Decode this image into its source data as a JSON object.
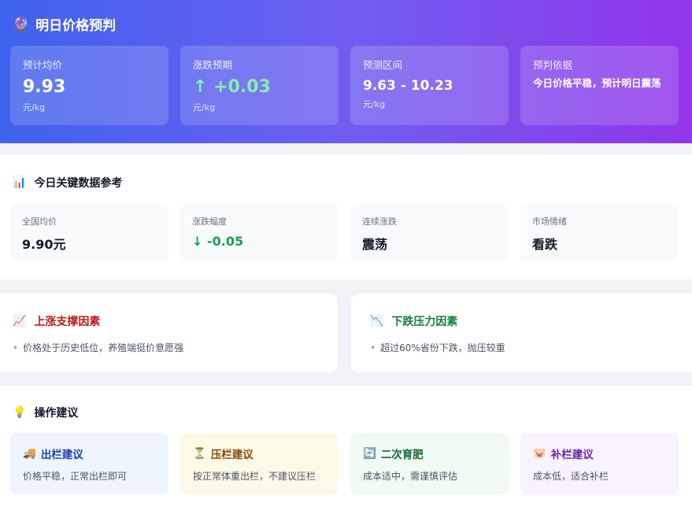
{
  "forecast": {
    "icon": "crystal-ball-person-icon",
    "title": "明日价格预判",
    "cards": {
      "avg": {
        "label": "预计均价",
        "value": "9.93",
        "unit": "元/kg"
      },
      "change": {
        "label": "涨跌预期",
        "value": "↑ +0.03",
        "unit": "元/kg"
      },
      "range": {
        "label": "预测区间",
        "value": "9.63 - 10.23",
        "unit": "元/kg"
      },
      "basis": {
        "label": "预判依据",
        "text": "今日价格平稳，预计明日震荡"
      }
    }
  },
  "today": {
    "icon": "bar-chart-icon",
    "title": "今日关键数据参考",
    "cards": [
      {
        "label": "全国均价",
        "value": "9.90元"
      },
      {
        "label": "涨跌幅度",
        "value": "↓ -0.05"
      },
      {
        "label": "连续涨跌",
        "value": "震荡"
      },
      {
        "label": "市场情绪",
        "value": "看跌"
      }
    ]
  },
  "factors": {
    "up": {
      "icon": "chart-increasing-icon",
      "title": "上涨支撑因素",
      "bullet": "•",
      "item": "价格处于历史低位，养殖端挺价意愿强"
    },
    "down": {
      "icon": "chart-decreasing-icon",
      "title": "下跌压力因素",
      "bullet": "•",
      "item": "超过60%省份下跌，抛压较重"
    }
  },
  "advice": {
    "icon": "light-bulb-icon",
    "title": "操作建议",
    "cards": [
      {
        "icon": "truck-icon",
        "emoji": "🚚",
        "title": "出栏建议",
        "desc": "价格平稳，正常出栏即可"
      },
      {
        "icon": "hourglass-icon",
        "emoji": "⏳",
        "title": "压栏建议",
        "desc": "按正常体重出栏，不建议压栏"
      },
      {
        "icon": "cycle-arrows-icon",
        "emoji": "🔄",
        "title": "二次育肥",
        "desc": "成本适中，需谨慎评估"
      },
      {
        "icon": "pig-face-icon",
        "emoji": "🐷",
        "title": "补栏建议",
        "desc": "成本低，适合补栏"
      }
    ]
  },
  "colors": {
    "hero_start": "#3f63ee",
    "hero_end": "#9235ea",
    "up_green": "#86efac",
    "down_green": "#16a34a",
    "factor_up_red": "#b91c1c",
    "factor_down_green": "#15803d"
  }
}
